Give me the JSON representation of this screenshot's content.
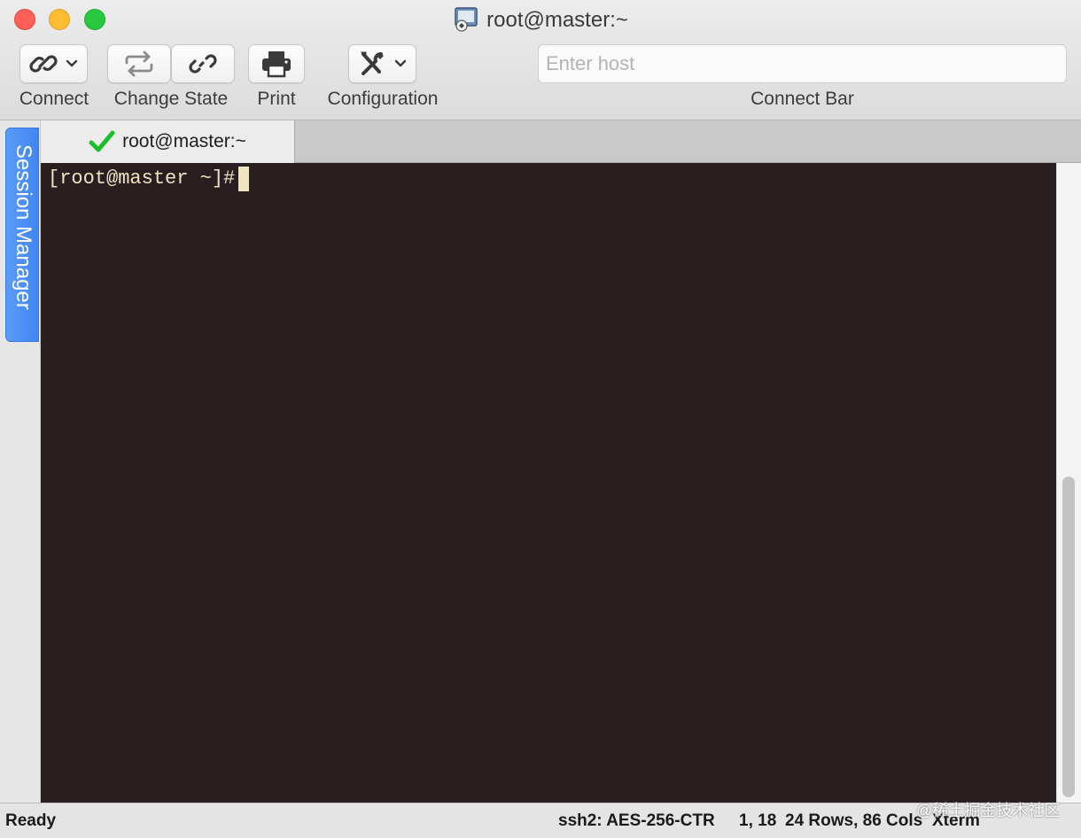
{
  "window": {
    "title": "root@master:~"
  },
  "toolbar": {
    "connect_label": "Connect",
    "change_state_label": "Change State",
    "print_label": "Print",
    "configuration_label": "Configuration",
    "connect_bar_label": "Connect Bar",
    "host_placeholder": "Enter host",
    "host_value": ""
  },
  "sidebar": {
    "session_manager_label": "Session Manager"
  },
  "tabs": [
    {
      "label": "root@master:~",
      "status": "connected",
      "status_icon": "checkmark-icon",
      "status_color": "#1fbf2a"
    }
  ],
  "terminal": {
    "prompt": "[root@master ~]#",
    "background": "#2a1f20",
    "foreground": "#efe3c2"
  },
  "status_bar": {
    "state": "Ready",
    "cipher": "ssh2: AES-256-CTR",
    "cursor_position": "1, 18",
    "rows_cols": "24 Rows, 86 Cols",
    "terminal_type": "Xterm",
    "watermark": "@稀土掘金技术社区"
  },
  "colors": {
    "session_tab": "#4a8ff5",
    "traffic_close": "#fe5f57",
    "traffic_minimize": "#febc2e",
    "traffic_maximize": "#28c840"
  }
}
